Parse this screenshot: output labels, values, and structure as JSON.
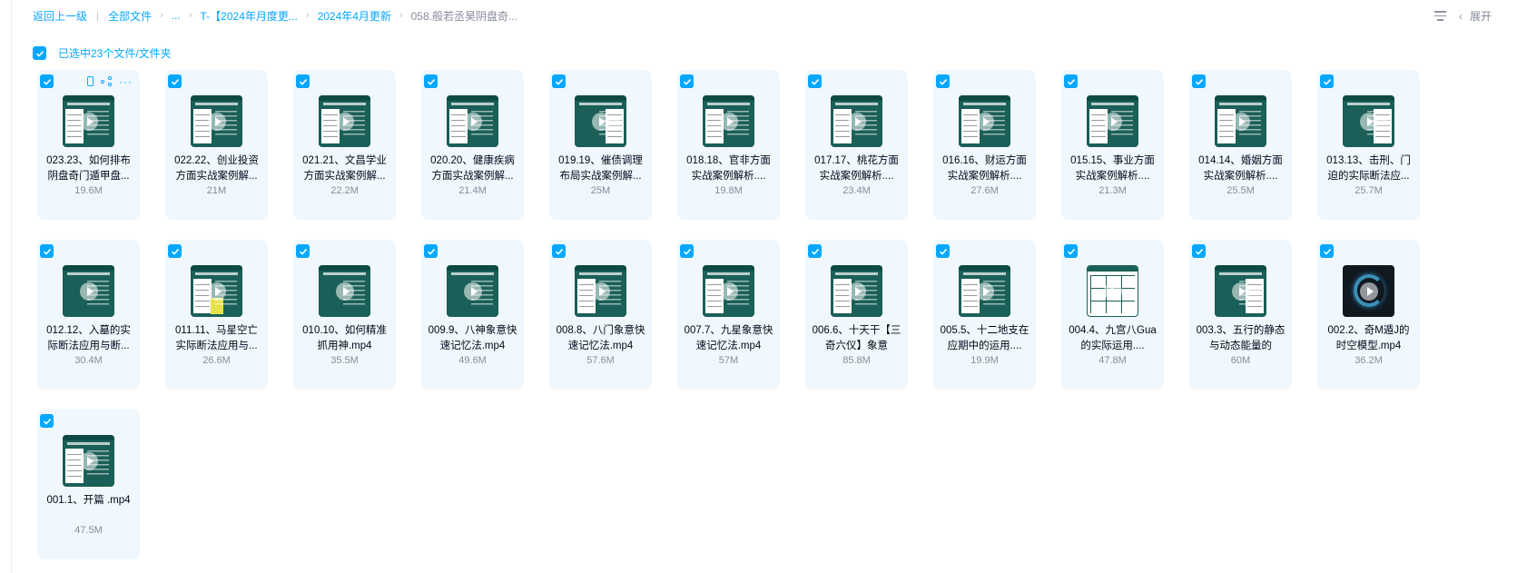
{
  "breadcrumb": {
    "back": "返回上一级",
    "root": "全部文件",
    "ellipsis": "...",
    "level1": "T-【2024年月度更...",
    "level2": "2024年4月更新",
    "current": "058.般若丞昊阴盘奇..."
  },
  "toolbar": {
    "expand_label": "展开"
  },
  "selection": {
    "label": "已选中23个文件/文件夹"
  },
  "colors": {
    "accent": "#06a7ff",
    "card_bg": "#f0f7fd",
    "thumb_teal": "#1a5f58"
  },
  "files": [
    {
      "name": "023.23、如何排布阴盘奇门遁甲盘...",
      "size": "19.6M",
      "thumb": "teal-sheet",
      "selected": true
    },
    {
      "name": "022.22、创业投资方面实战案例解...",
      "size": "21M",
      "thumb": "teal-sheet",
      "selected": true
    },
    {
      "name": "021.21、文昌学业方面实战案例解...",
      "size": "22.2M",
      "thumb": "teal-sheet",
      "selected": true
    },
    {
      "name": "020.20、健康疾病方面实战案例解...",
      "size": "21.4M",
      "thumb": "teal-sheet",
      "selected": true
    },
    {
      "name": "019.19、催债调理布局实战案例解...",
      "size": "25M",
      "thumb": "teal-sheet-right",
      "selected": true
    },
    {
      "name": "018.18、官非方面实战案例解析....",
      "size": "19.8M",
      "thumb": "teal-sheet",
      "selected": true
    },
    {
      "name": "017.17、桃花方面实战案例解析....",
      "size": "23.4M",
      "thumb": "teal-sheet",
      "selected": true
    },
    {
      "name": "016.16、财运方面实战案例解析....",
      "size": "27.6M",
      "thumb": "teal-sheet",
      "selected": true
    },
    {
      "name": "015.15、事业方面实战案例解析....",
      "size": "21.3M",
      "thumb": "teal-sheet",
      "selected": true
    },
    {
      "name": "014.14、婚姻方面实战案例解析....",
      "size": "25.5M",
      "thumb": "teal-sheet",
      "selected": true
    },
    {
      "name": "013.13、击刑、门迫的实际断法应...",
      "size": "25.7M",
      "thumb": "teal-sheet-right",
      "selected": true
    },
    {
      "name": "012.12、入墓的实际断法应用与断...",
      "size": "30.4M",
      "thumb": "teal-rows",
      "selected": true
    },
    {
      "name": "011.11、马星空亡实际断法应用与...",
      "size": "26.6M",
      "thumb": "teal-yellow",
      "selected": true
    },
    {
      "name": "010.10、如何精准抓用神.mp4",
      "size": "35.5M",
      "thumb": "teal-rows",
      "selected": true
    },
    {
      "name": "009.9、八神象意快速记忆法.mp4",
      "size": "49.6M",
      "thumb": "teal-rows",
      "selected": true
    },
    {
      "name": "008.8、八门象意快速记忆法.mp4",
      "size": "57.6M",
      "thumb": "teal-sheet",
      "selected": true
    },
    {
      "name": "007.7、九星象意快速记忆法.mp4",
      "size": "57M",
      "thumb": "teal-sheet",
      "selected": true
    },
    {
      "name": "006.6、十天干【三奇六仪】象意",
      "size": "85.8M",
      "thumb": "teal-sheet",
      "selected": true
    },
    {
      "name": "005.5、十二地支在应期中的运用....",
      "size": "19.9M",
      "thumb": "teal-sheet",
      "selected": true
    },
    {
      "name": "004.4、九宫八Gua的实际运用....",
      "size": "47.8M",
      "thumb": "grid",
      "selected": true
    },
    {
      "name": "003.3、五行的静态与动态能量的",
      "size": "60M",
      "thumb": "teal-sheet-right",
      "selected": true
    },
    {
      "name": "002.2、奇M遁J的时空模型.mp4",
      "size": "36.2M",
      "thumb": "dark",
      "selected": true
    },
    {
      "name": "001.1、开篇 .mp4",
      "size": "47.5M",
      "thumb": "teal-sheet",
      "selected": true
    }
  ]
}
